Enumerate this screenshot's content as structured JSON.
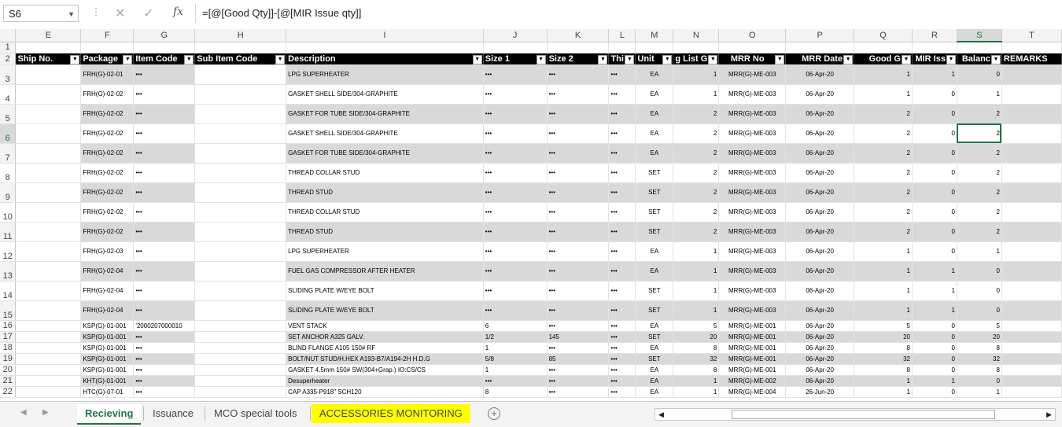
{
  "formula_bar": {
    "name_box": "S6",
    "formula": "=[@[Good Qty]]-[@[MIR Issue qty]]"
  },
  "col_headers": [
    "E",
    "F",
    "G",
    "H",
    "I",
    "J",
    "K",
    "L",
    "M",
    "N",
    "O",
    "P",
    "Q",
    "R",
    "S",
    "T"
  ],
  "selected_col": "S",
  "table_headers": [
    "Ship No.",
    "Package",
    "Item Code",
    "Sub Item Code",
    "Description",
    "Size 1",
    "Size 2",
    "Thi",
    "Unit",
    "g List G",
    "MRR No",
    "MRR Date",
    "Good G",
    "MIR Iss",
    "Balanc",
    "REMARKS"
  ],
  "rows": [
    {
      "n": "3",
      "pkg": "FRH(G)-02-01",
      "item": "•••",
      "desc": "LPG SUPERHEATER",
      "s1": "•••",
      "s2": "•••",
      "th": "•••",
      "unit": "EA",
      "pl": "1",
      "mrr": "MRR(G)-ME-003",
      "date": "06-Apr-20",
      "good": "1",
      "mir": "1",
      "bal": "0"
    },
    {
      "n": "4",
      "pkg": "FRH(G)-02-02",
      "item": "•••",
      "desc": "GASKET SHELL SIDE/304-GRAPHITE",
      "s1": "•••",
      "s2": "•••",
      "th": "•••",
      "unit": "EA",
      "pl": "1",
      "mrr": "MRR(G)-ME-003",
      "date": "06-Apr-20",
      "good": "1",
      "mir": "0",
      "bal": "1"
    },
    {
      "n": "5",
      "pkg": "FRH(G)-02-02",
      "item": "•••",
      "desc": "GASKET FOR TUBE SIDE/304-GRAPHITE",
      "s1": "•••",
      "s2": "•••",
      "th": "•••",
      "unit": "EA",
      "pl": "2",
      "mrr": "MRR(G)-ME-003",
      "date": "06-Apr-20",
      "good": "2",
      "mir": "0",
      "bal": "2"
    },
    {
      "n": "6",
      "pkg": "FRH(G)-02-02",
      "item": "•••",
      "desc": "GASKET SHELL SIDE/304-GRAPHITE",
      "s1": "•••",
      "s2": "•••",
      "th": "•••",
      "unit": "EA",
      "pl": "2",
      "mrr": "MRR(G)-ME-003",
      "date": "06-Apr-20",
      "good": "2",
      "mir": "0",
      "bal": "2"
    },
    {
      "n": "7",
      "pkg": "FRH(G)-02-02",
      "item": "•••",
      "desc": "GASKET FOR TUBE SIDE/304-GRAPHITE",
      "s1": "•••",
      "s2": "•••",
      "th": "•••",
      "unit": "EA",
      "pl": "2",
      "mrr": "MRR(G)-ME-003",
      "date": "06-Apr-20",
      "good": "2",
      "mir": "0",
      "bal": "2"
    },
    {
      "n": "8",
      "pkg": "FRH(G)-02-02",
      "item": "•••",
      "desc": "THREAD COLLAR STUD",
      "s1": "•••",
      "s2": "•••",
      "th": "•••",
      "unit": "SET",
      "pl": "2",
      "mrr": "MRR(G)-ME-003",
      "date": "06-Apr-20",
      "good": "2",
      "mir": "0",
      "bal": "2"
    },
    {
      "n": "9",
      "pkg": "FRH(G)-02-02",
      "item": "•••",
      "desc": "THREAD STUD",
      "s1": "•••",
      "s2": "•••",
      "th": "•••",
      "unit": "SET",
      "pl": "2",
      "mrr": "MRR(G)-ME-003",
      "date": "06-Apr-20",
      "good": "2",
      "mir": "0",
      "bal": "2"
    },
    {
      "n": "10",
      "pkg": "FRH(G)-02-02",
      "item": "•••",
      "desc": "THREAD COLLAR STUD",
      "s1": "•••",
      "s2": "•••",
      "th": "•••",
      "unit": "SET",
      "pl": "2",
      "mrr": "MRR(G)-ME-003",
      "date": "06-Apr-20",
      "good": "2",
      "mir": "0",
      "bal": "2"
    },
    {
      "n": "11",
      "pkg": "FRH(G)-02-02",
      "item": "•••",
      "desc": "THREAD STUD",
      "s1": "•••",
      "s2": "•••",
      "th": "•••",
      "unit": "SET",
      "pl": "2",
      "mrr": "MRR(G)-ME-003",
      "date": "06-Apr-20",
      "good": "2",
      "mir": "0",
      "bal": "2"
    },
    {
      "n": "12",
      "pkg": "FRH(G)-02-03",
      "item": "•••",
      "desc": "LPG SUPERHEATER",
      "s1": "•••",
      "s2": "•••",
      "th": "•••",
      "unit": "EA",
      "pl": "1",
      "mrr": "MRR(G)-ME-003",
      "date": "06-Apr-20",
      "good": "1",
      "mir": "0",
      "bal": "1"
    },
    {
      "n": "13",
      "pkg": "FRH(G)-02-04",
      "item": "•••",
      "desc": "FUEL GAS COMPRESSOR AFTER HEATER",
      "s1": "•••",
      "s2": "•••",
      "th": "•••",
      "unit": "EA",
      "pl": "1",
      "mrr": "MRR(G)-ME-003",
      "date": "06-Apr-20",
      "good": "1",
      "mir": "1",
      "bal": "0"
    },
    {
      "n": "14",
      "pkg": "FRH(G)-02-04",
      "item": "•••",
      "desc": "SLIDING PLATE W/EYE BOLT",
      "s1": "•••",
      "s2": "•••",
      "th": "•••",
      "unit": "SET",
      "pl": "1",
      "mrr": "MRR(G)-ME-003",
      "date": "06-Apr-20",
      "good": "1",
      "mir": "1",
      "bal": "0"
    },
    {
      "n": "15",
      "pkg": "FRH(G)-02-04",
      "item": "•••",
      "desc": "SLIDING PLATE W/EYE BOLT",
      "s1": "•••",
      "s2": "•••",
      "th": "•••",
      "unit": "SET",
      "pl": "1",
      "mrr": "MRR(G)-ME-003",
      "date": "06-Apr-20",
      "good": "1",
      "mir": "1",
      "bal": "0"
    },
    {
      "n": "16",
      "pkg": "KSP(G)-01-001",
      "item": "'2000207000010",
      "desc": "VENT STACK",
      "s1": "6",
      "s2": "•••",
      "th": "•••",
      "unit": "EA",
      "pl": "5",
      "mrr": "MRR(G)-ME-001",
      "date": "06-Apr-20",
      "good": "5",
      "mir": "0",
      "bal": "5"
    },
    {
      "n": "17",
      "pkg": "KSP(G)-01-001",
      "item": "•••",
      "desc": "SET ANCHOR A325 GALV.",
      "s1": "1/2",
      "s2": "145",
      "th": "•••",
      "unit": "SET",
      "pl": "20",
      "mrr": "MRR(G)-ME-001",
      "date": "06-Apr-20",
      "good": "20",
      "mir": "0",
      "bal": "20"
    },
    {
      "n": "18",
      "pkg": "KSP(G)-01-001",
      "item": "•••",
      "desc": "BLIND FLANGE A105 150# RF",
      "s1": "1",
      "s2": "•••",
      "th": "•••",
      "unit": "EA",
      "pl": "8",
      "mrr": "MRR(G)-ME-001",
      "date": "06-Apr-20",
      "good": "8",
      "mir": "0",
      "bal": "8"
    },
    {
      "n": "19",
      "pkg": "KSP(G)-01-001",
      "item": "•••",
      "desc": "BOLT/NUT STUD/H.HEX A193-B7/A194-2H H.D.G",
      "s1": "5/8",
      "s2": "85",
      "th": "•••",
      "unit": "SET",
      "pl": "32",
      "mrr": "MRR(G)-ME-001",
      "date": "06-Apr-20",
      "good": "32",
      "mir": "0",
      "bal": "32"
    },
    {
      "n": "20",
      "pkg": "KSP(G)-01-001",
      "item": "•••",
      "desc": "GASKET 4.5mm 150# SW(304+Grap.) IO:CS/CS",
      "s1": "1",
      "s2": "•••",
      "th": "•••",
      "unit": "EA",
      "pl": "8",
      "mrr": "MRR(G)-ME-001",
      "date": "06-Apr-20",
      "good": "8",
      "mir": "0",
      "bal": "8"
    },
    {
      "n": "21",
      "pkg": "KHT(G)-01-001",
      "item": "•••",
      "desc": "Desuperheater",
      "s1": "•••",
      "s2": "•••",
      "th": "•••",
      "unit": "EA",
      "pl": "1",
      "mrr": "MRR(G)-ME-002",
      "date": "06-Apr-20",
      "good": "1",
      "mir": "1",
      "bal": "0"
    },
    {
      "n": "22",
      "pkg": "HTC(G)-07-01",
      "item": "•••",
      "desc": "CAP A335-P918\" SCH120",
      "s1": "8",
      "s2": "•••",
      "th": "•••",
      "unit": "EA",
      "pl": "1",
      "mrr": "MRR(G)-ME-004",
      "date": "26-Jun-20",
      "good": "1",
      "mir": "0",
      "bal": "1"
    }
  ],
  "sheet_tabs": [
    {
      "label": "Recieving",
      "state": "active"
    },
    {
      "label": "Issuance",
      "state": "normal"
    },
    {
      "label": "MCO special tools",
      "state": "normal"
    },
    {
      "label": "ACCESSORIES MONITORING",
      "state": "yellow"
    }
  ],
  "colors": {
    "accent": "#217346",
    "band": "#d9d9d9",
    "header": "#000000",
    "yellow_tab": "#ffff00"
  }
}
